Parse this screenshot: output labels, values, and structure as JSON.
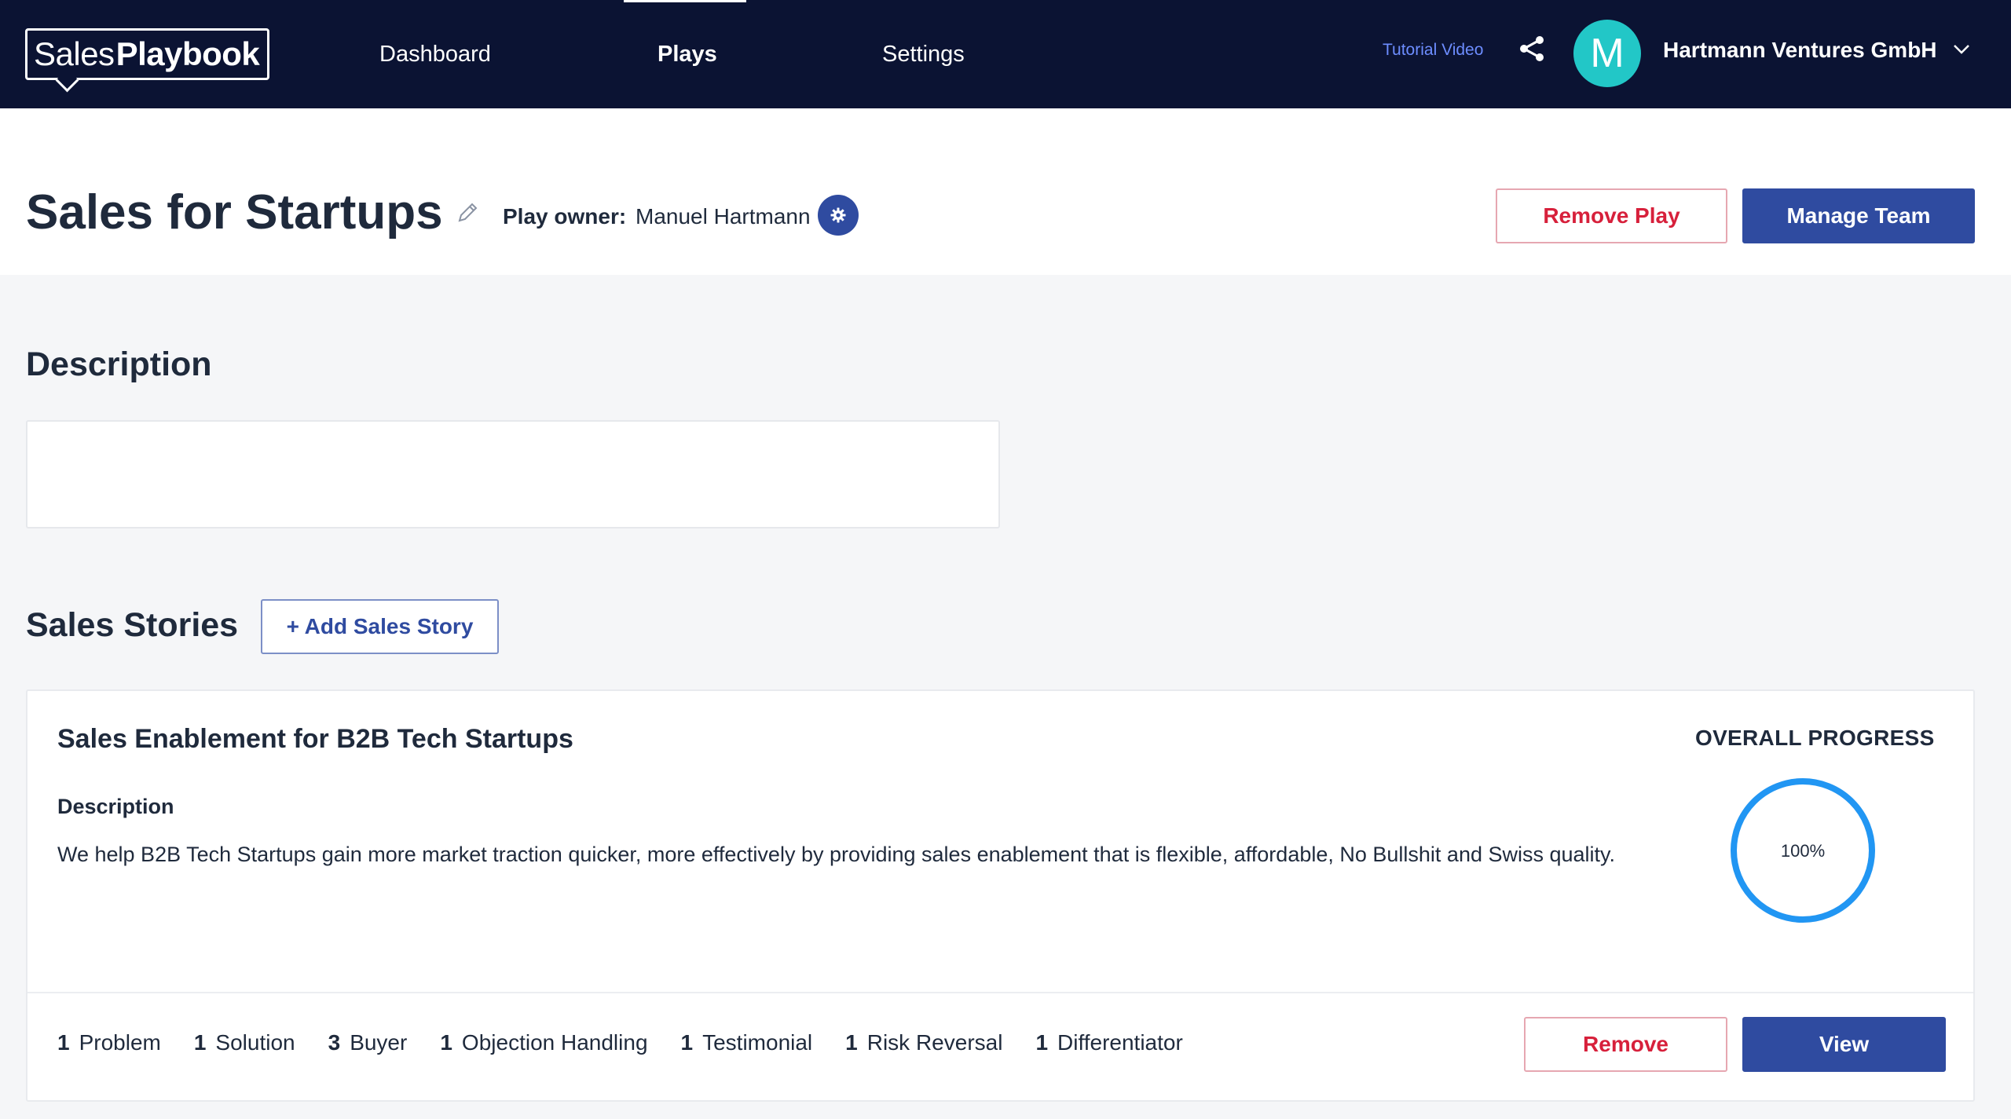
{
  "nav": {
    "logo_sales": "Sales",
    "logo_playbook": "Playbook",
    "items": [
      {
        "label": "Dashboard"
      },
      {
        "label": "Plays"
      },
      {
        "label": "Settings"
      }
    ],
    "active_item": "Plays",
    "tutorial_link": "Tutorial Video",
    "share_icon": "share-icon",
    "avatar_initial": "M",
    "company_name": "Hartmann Ventures GmbH",
    "dropdown_icon": "chevron-down-icon"
  },
  "header": {
    "title": "Sales for Startups",
    "edit_icon": "pencil-icon",
    "owner_label": "Play owner:",
    "owner_name": "Manuel Hartmann",
    "owner_settings_icon": "gear-icon",
    "remove_play_label": "Remove Play",
    "manage_team_label": "Manage Team"
  },
  "description": {
    "title": "Description",
    "value": ""
  },
  "sales_stories": {
    "title": "Sales Stories",
    "add_label": "+ Add Sales Story",
    "stories": [
      {
        "title": "Sales Enablement for B2B Tech Startups",
        "description_label": "Description",
        "description": "We help B2B Tech Startups gain more market traction quicker, more effectively by providing sales enablement that is flexible, affordable, No Bullshit and Swiss quality.",
        "progress_label": "OVERALL PROGRESS",
        "progress_text": "100%",
        "progress_value": 100,
        "counts": [
          {
            "num": "1",
            "label": "Problem"
          },
          {
            "num": "1",
            "label": "Solution"
          },
          {
            "num": "3",
            "label": "Buyer"
          },
          {
            "num": "1",
            "label": "Objection Handling"
          },
          {
            "num": "1",
            "label": "Testimonial"
          },
          {
            "num": "1",
            "label": "Risk Reversal"
          },
          {
            "num": "1",
            "label": "Differentiator"
          }
        ],
        "remove_label": "Remove",
        "view_label": "View"
      }
    ]
  },
  "colors": {
    "nav_bg": "#0b1333",
    "primary": "#2f4ba0",
    "danger": "#d7203b",
    "avatar": "#22c7c7",
    "progress": "#2196f3",
    "link": "#6d8dff"
  }
}
